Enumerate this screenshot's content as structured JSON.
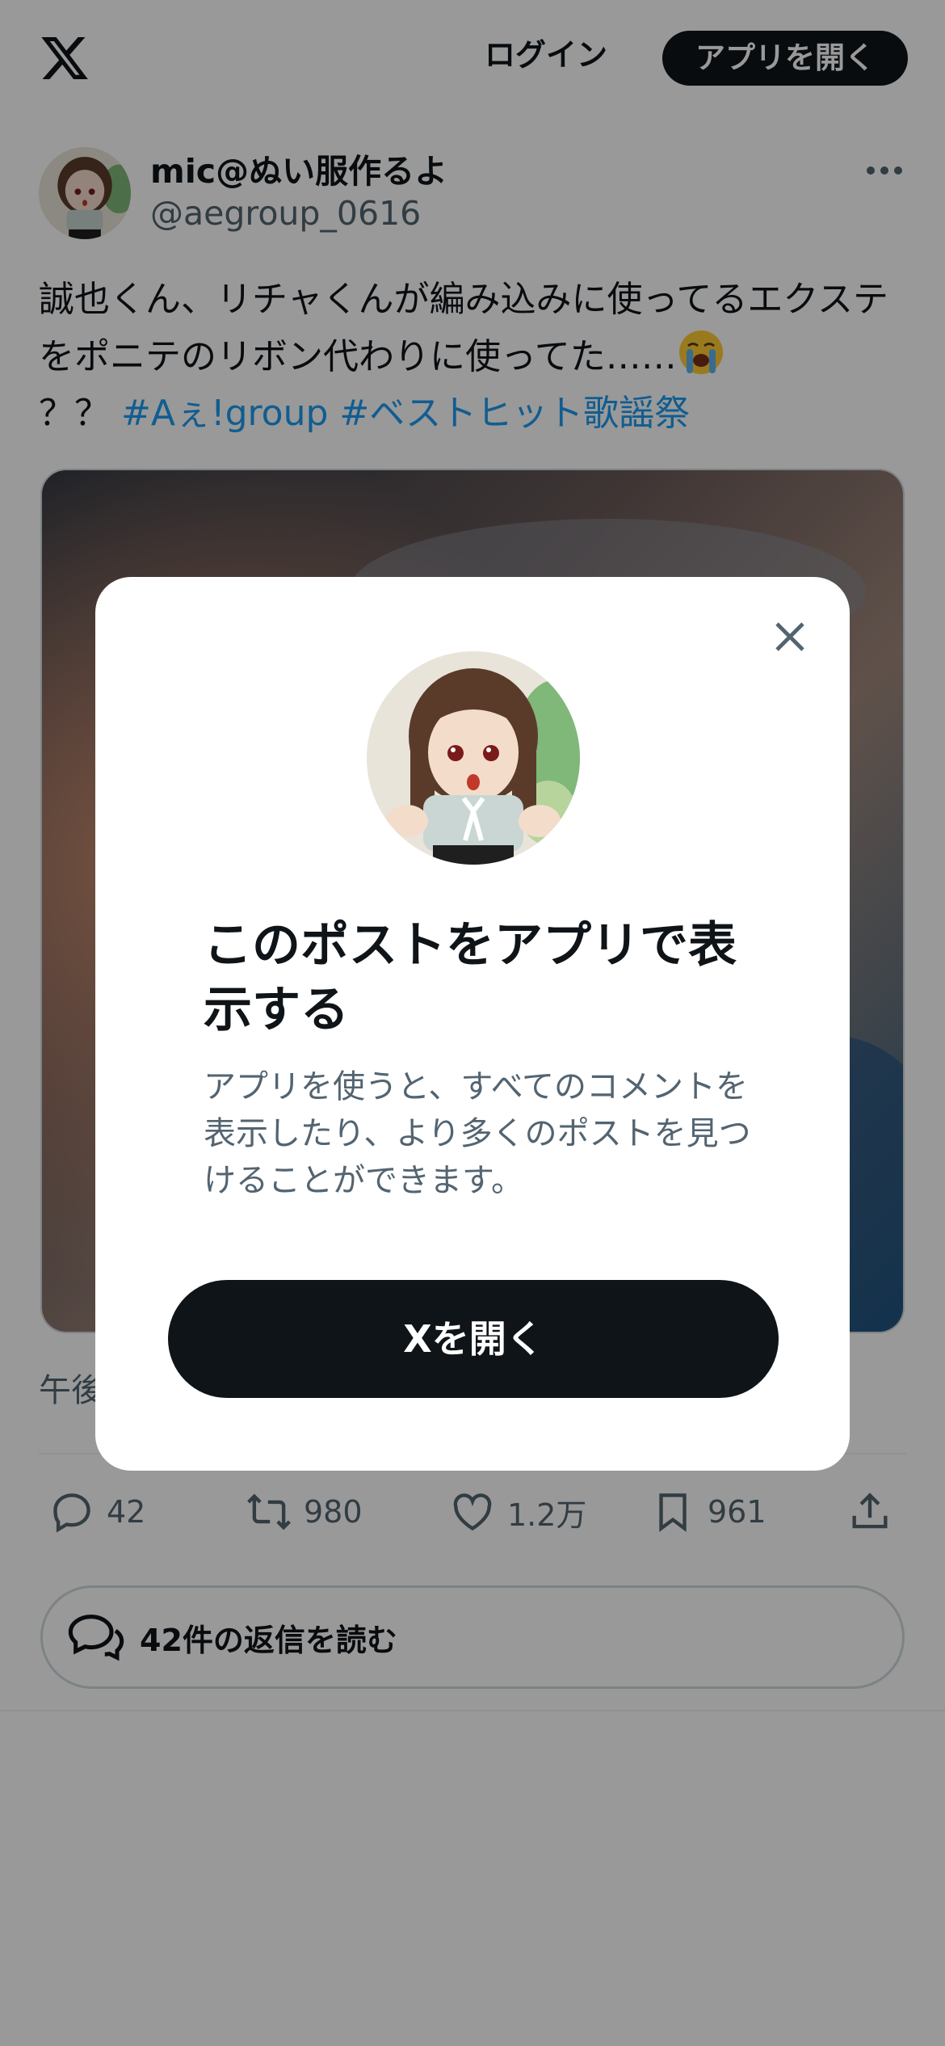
{
  "header": {
    "login_label": "ログイン",
    "open_app_label": "アプリを開く"
  },
  "post": {
    "author_name": "mic@ぬい服作るよ",
    "author_handle": "@aegroup_0616",
    "text_main": "誠也くん、リチャくんが編み込みに使ってるエクステをポニテのリボン代わりに使ってた……",
    "text_tail": "？？ ",
    "hashtag_1": "#Aぇ!group",
    "hashtag_2": "#ベストヒット歌謡祭",
    "timestamp": "午後"
  },
  "actions": {
    "replies": "42",
    "reposts": "980",
    "likes": "1.2万",
    "bookmarks": "961"
  },
  "read_replies_label": "42件の返信を読む",
  "modal": {
    "title": "このポストをアプリで表示する",
    "subtitle": "アプリを使うと、すべてのコメントを表示したり、より多くのポストを見つけることができます。",
    "button_label": "Xを開く"
  },
  "colors": {
    "text": "#0f1419",
    "secondary": "#536471",
    "link": "#1d9bf0",
    "button": "#0f1419"
  }
}
